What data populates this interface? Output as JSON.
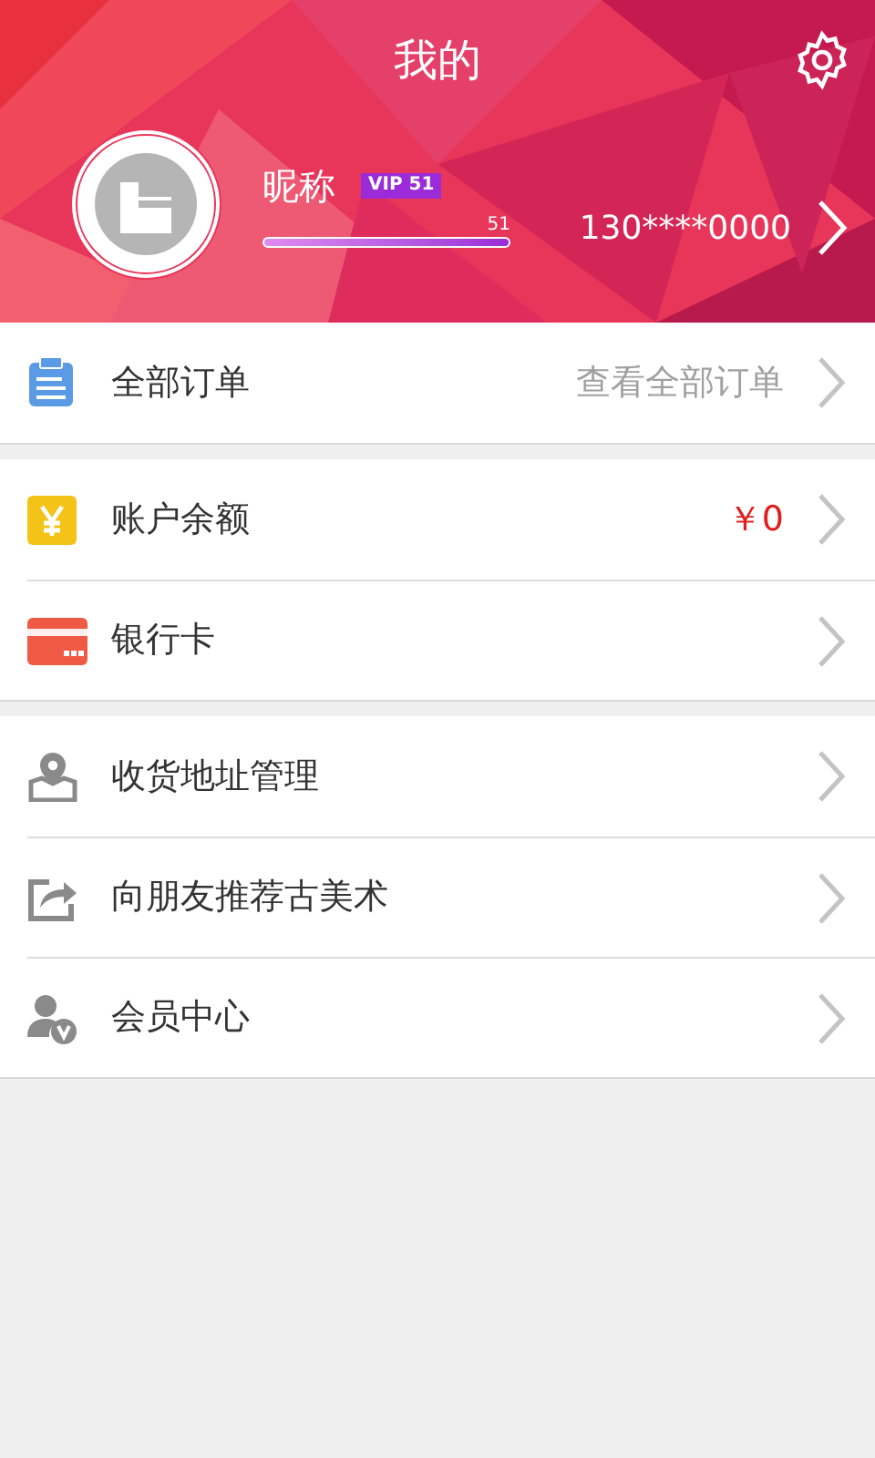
{
  "header": {
    "title": "我的",
    "nickname": "昵称",
    "vip_badge": "VIP 51",
    "level_label": "51",
    "level": 1,
    "phone": "130****0000"
  },
  "sections": [
    {
      "rows": [
        {
          "kind": "orders",
          "label": "全部订单",
          "value": "查看全部订单",
          "alert": false
        }
      ]
    },
    {
      "rows": [
        {
          "kind": "balance",
          "label": "账户余额",
          "value": "￥0",
          "alert": true
        },
        {
          "kind": "card",
          "label": "银行卡"
        }
      ]
    },
    {
      "rows": [
        {
          "kind": "address",
          "label": "收货地址管理"
        },
        {
          "kind": "share",
          "label": "向朋友推荐古美术"
        },
        {
          "kind": "member",
          "label": "会员中心"
        }
      ]
    }
  ]
}
